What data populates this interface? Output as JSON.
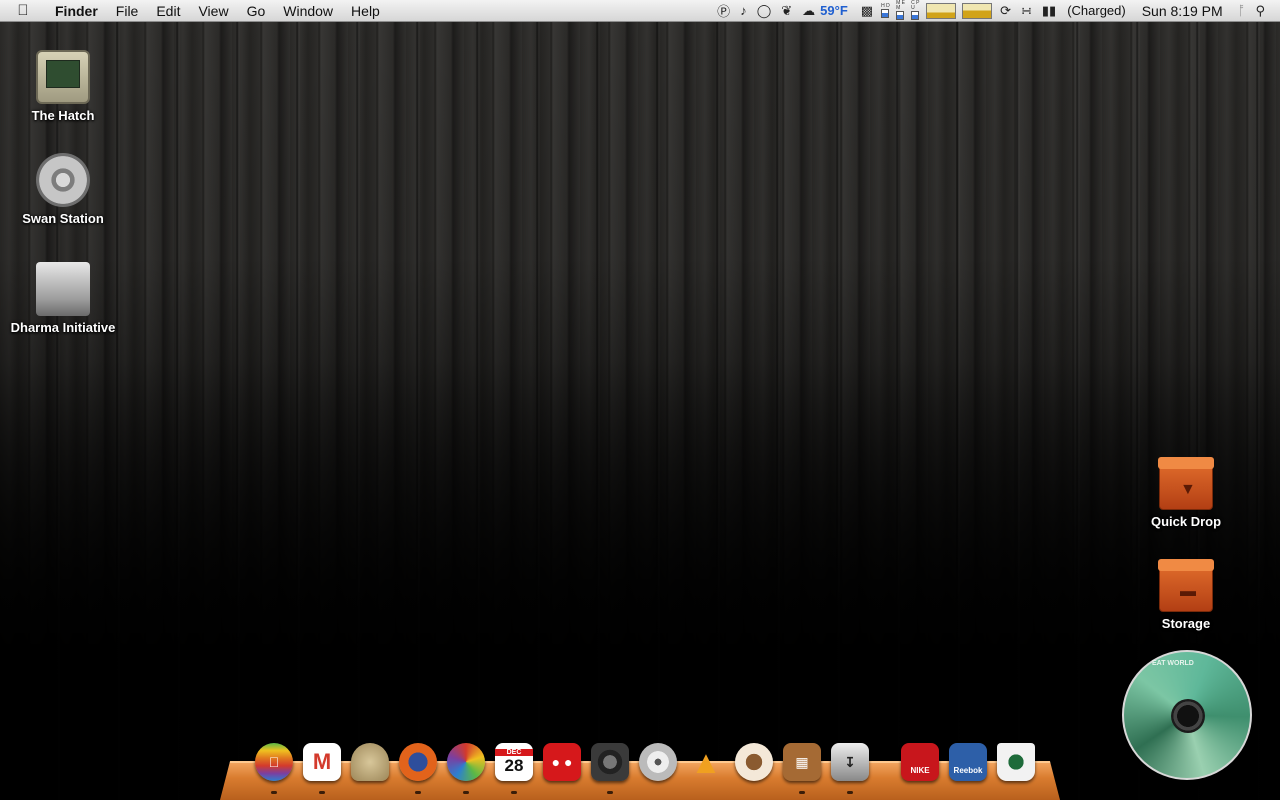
{
  "menubar": {
    "apple_icon": "apple-logo-icon",
    "app_name": "Finder",
    "menus": [
      "File",
      "Edit",
      "View",
      "Go",
      "Window",
      "Help"
    ],
    "weather_temp": "59°F",
    "battery_status": "(Charged)",
    "clock": "Sun 8:19 PM",
    "meter_labels": [
      "H D",
      "M E M",
      "C P U"
    ]
  },
  "desktop_icons_left": [
    {
      "label": "The Hatch",
      "icon": "computer-terminal-icon"
    },
    {
      "label": "Swan Station",
      "icon": "dharma-swan-logo-icon"
    },
    {
      "label": "Dharma Initiative",
      "icon": "hard-drive-icon"
    }
  ],
  "desktop_icons_right": [
    {
      "label": "Quick Drop",
      "icon": "orange-box-drop-icon"
    },
    {
      "label": "Storage",
      "icon": "orange-box-storage-icon"
    }
  ],
  "cd_widget": {
    "text": "EAT WORLD",
    "icon": "album-cd-icon"
  },
  "dock": {
    "calendar_month": "DEC",
    "calendar_day": "28",
    "nike_text": "NIKE",
    "reebok_text": "Reebok",
    "items": [
      {
        "name": "finder-apple-icon",
        "color": "#e0781f"
      },
      {
        "name": "gmail-icon",
        "color": "#d33a2c"
      },
      {
        "name": "safari-helmet-icon",
        "color": "#bfa97a"
      },
      {
        "name": "firefox-icon",
        "color": "#e2631b"
      },
      {
        "name": "itunes-headphones-icon",
        "color": "#6b6b6b"
      },
      {
        "name": "calendar-icon",
        "color": "#ffffff"
      },
      {
        "name": "red-app-icon",
        "color": "#d6181b"
      },
      {
        "name": "camera-icon",
        "color": "#3a3a3a"
      },
      {
        "name": "disc-burner-icon",
        "color": "#cfcfcf"
      },
      {
        "name": "vlc-cone-icon",
        "color": "#f0a020"
      },
      {
        "name": "coffee-cup-icon",
        "color": "#d8c0a0"
      },
      {
        "name": "cabinet-icon",
        "color": "#a56a34"
      },
      {
        "name": "installer-icon",
        "color": "#5c5c5c"
      },
      {
        "name": "nike-box-icon",
        "color": "#c8161c"
      },
      {
        "name": "reebok-box-icon",
        "color": "#2d5fa8"
      },
      {
        "name": "starbucks-trash-icon",
        "color": "#f2f2f2"
      }
    ]
  }
}
